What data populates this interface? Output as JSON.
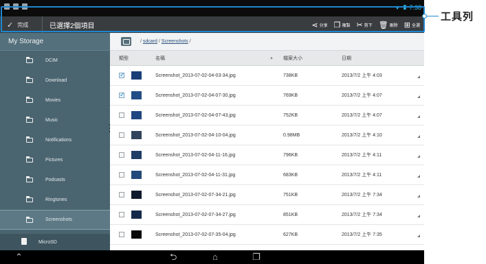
{
  "callout": {
    "label": "工具列"
  },
  "toolbar": {
    "done_label": "完成",
    "selection_count": "已選擇2個項目",
    "actions": [
      {
        "name": "share",
        "icon": "share-icon",
        "glyph": "⋖",
        "label": "分享"
      },
      {
        "name": "copy",
        "icon": "copy-icon",
        "glyph": "❐",
        "label": "複製"
      },
      {
        "name": "cut",
        "icon": "scissors-icon",
        "glyph": "✂",
        "label": "剪下"
      },
      {
        "name": "delete",
        "icon": "trash-icon",
        "glyph": "🗑",
        "label": "刪除"
      },
      {
        "name": "select-all",
        "icon": "select-all-icon",
        "glyph": "⊞",
        "label": "全選"
      }
    ]
  },
  "statusbar": {
    "time": "7:38",
    "wifi_glyph": "▼",
    "battery_glyph": "▮"
  },
  "sidebar": {
    "header": "My Storage",
    "items": [
      {
        "label": "DCIM",
        "active": false
      },
      {
        "label": "Download",
        "active": false
      },
      {
        "label": "Movies",
        "active": false
      },
      {
        "label": "Music",
        "active": false
      },
      {
        "label": "Notifications",
        "active": false
      },
      {
        "label": "Pictures",
        "active": false
      },
      {
        "label": "Podcasts",
        "active": false
      },
      {
        "label": "Ringtones",
        "active": false
      },
      {
        "label": "Screenshots",
        "active": true
      }
    ],
    "microsd": "MicroSD"
  },
  "breadcrumb": {
    "sep1": "/",
    "part1": "sdcard",
    "sep2": "/",
    "part2": "Screenshots",
    "sep3": "/"
  },
  "columns": {
    "type": "類型",
    "name": "名稱",
    "sort": "▲",
    "size": "檔案大小",
    "date": "日期"
  },
  "files": [
    {
      "name": "Screenshot_2013-07-02-04-03-34.jpg",
      "size": "738KB",
      "date": "2013/7/2 上午 4:03",
      "checked": true,
      "thumb": "#1a3f78"
    },
    {
      "name": "Screenshot_2013-07-02-04-07-30.jpg",
      "size": "769KB",
      "date": "2013/7/2 上午 4:07",
      "checked": true,
      "thumb": "#224d86"
    },
    {
      "name": "Screenshot_2013-07-02-04-07-43.jpg",
      "size": "752KB",
      "date": "2013/7/2 上午 4:07",
      "checked": false,
      "thumb": "#1f4680"
    },
    {
      "name": "Screenshot_2013-07-02-04-10-04.jpg",
      "size": "0.98MB",
      "date": "2013/7/2 上午 4:10",
      "checked": false,
      "thumb": "#31445c"
    },
    {
      "name": "Screenshot_2013-07-02-04-11-16.jpg",
      "size": "796KB",
      "date": "2013/7/2 上午 4:11",
      "checked": false,
      "thumb": "#1d3d66"
    },
    {
      "name": "Screenshot_2013-07-02-04-11-31.jpg",
      "size": "683KB",
      "date": "2013/7/2 上午 4:11",
      "checked": false,
      "thumb": "#224a7a"
    },
    {
      "name": "Screenshot_2013-07-02-07-34-21.jpg",
      "size": "751KB",
      "date": "2013/7/2 上午 7:34",
      "checked": false,
      "thumb": "#0d1a2e"
    },
    {
      "name": "Screenshot_2013-07-02-07-34-27.jpg",
      "size": "851KB",
      "date": "2013/7/2 上午 7:34",
      "checked": false,
      "thumb": "#132a4a"
    },
    {
      "name": "Screenshot_2013-07-02-07-35-04.jpg",
      "size": "627KB",
      "date": "2013/7/2 上午 7:35",
      "checked": false,
      "thumb": "#0a0a0a"
    }
  ],
  "navbar": {
    "menu_glyph": "⌃",
    "back_glyph": "⮌",
    "home_glyph": "⌂",
    "recent_glyph": "❐"
  },
  "colors": {
    "accent": "#33b5e5",
    "highlight": "#1e88d0",
    "sidebar": "#4b6570"
  }
}
